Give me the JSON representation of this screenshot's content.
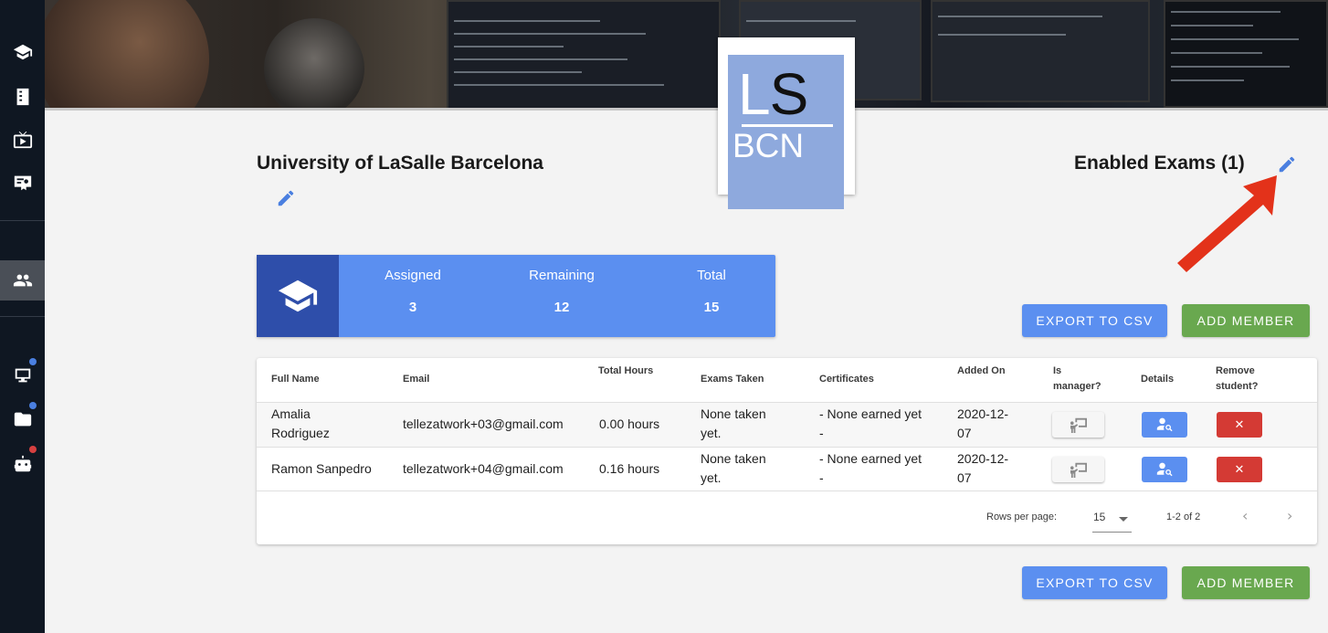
{
  "sidebar": {
    "items": [
      {
        "name": "graduation-cap-icon"
      },
      {
        "name": "book-icon"
      },
      {
        "name": "tv-icon"
      },
      {
        "name": "certificate-icon"
      },
      {
        "name": "people-icon",
        "active": true
      },
      {
        "name": "computer-icon",
        "badge": "#4a7fe0"
      },
      {
        "name": "folder-icon",
        "badge": "#4a7fe0"
      },
      {
        "name": "robot-icon",
        "badge": "#d64040"
      }
    ]
  },
  "logo": {
    "line1": "LS",
    "line2": "BCN",
    "color": "#8ea9dd"
  },
  "organization": {
    "title": "University of LaSalle Barcelona"
  },
  "exams": {
    "title": "Enabled Exams (1)"
  },
  "stats": {
    "assigned_label": "Assigned",
    "assigned_value": "3",
    "remaining_label": "Remaining",
    "remaining_value": "12",
    "total_label": "Total",
    "total_value": "15"
  },
  "actions": {
    "export_label": "EXPORT TO CSV",
    "add_label": "ADD MEMBER"
  },
  "table": {
    "headers": {
      "full_name": "Full Name",
      "email": "Email",
      "total_hours": "Total Hours",
      "exams_taken": "Exams Taken",
      "certificates": "Certificates",
      "added_on": "Added On",
      "is_manager_1": "Is",
      "is_manager_2": "manager?",
      "details": "Details",
      "remove_1": "Remove",
      "remove_2": "student?"
    },
    "rows": [
      {
        "name_1": "Amalia",
        "name_2": "Rodriguez",
        "email": "tellezatwork+03@gmail.com",
        "hours": "0.00 hours",
        "exams_1": "None taken",
        "exams_2": "yet.",
        "cert_1": "- None earned yet",
        "cert_2": "-",
        "added_1": "2020-12-",
        "added_2": "07"
      },
      {
        "name_1": "Ramon Sanpedro",
        "name_2": "",
        "email": "tellezatwork+04@gmail.com",
        "hours": "0.16 hours",
        "exams_1": "None taken",
        "exams_2": "yet.",
        "cert_1": "- None earned yet",
        "cert_2": "-",
        "added_1": "2020-12-",
        "added_2": "07"
      }
    ],
    "remove_glyph": "✕",
    "footer": {
      "rows_per_page_label": "Rows per page:",
      "rows_per_page_value": "15",
      "range": "1-2 of 2"
    }
  },
  "colors": {
    "primary": "#5b8ff0",
    "success": "#69a84f",
    "danger": "#d43a34",
    "sidebar": "#0f1722",
    "stats_dark": "#2e4eaa"
  }
}
